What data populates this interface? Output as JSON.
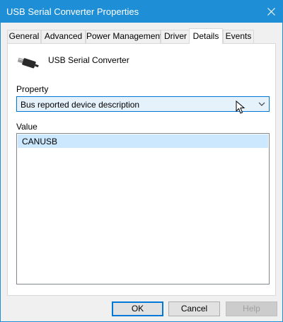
{
  "window": {
    "title": "USB Serial Converter Properties",
    "titlebar_color": "#1e8fd6"
  },
  "tabs": [
    {
      "label": "General"
    },
    {
      "label": "Advanced"
    },
    {
      "label": "Power Management"
    },
    {
      "label": "Driver"
    },
    {
      "label": "Details",
      "active": true
    },
    {
      "label": "Events"
    }
  ],
  "device": {
    "name": "USB Serial Converter",
    "icon": "usb-plug-icon"
  },
  "property": {
    "label": "Property",
    "selected": "Bus reported device description"
  },
  "value": {
    "label": "Value",
    "items": [
      "CANUSB"
    ]
  },
  "buttons": {
    "ok": "OK",
    "cancel": "Cancel",
    "help": "Help"
  }
}
